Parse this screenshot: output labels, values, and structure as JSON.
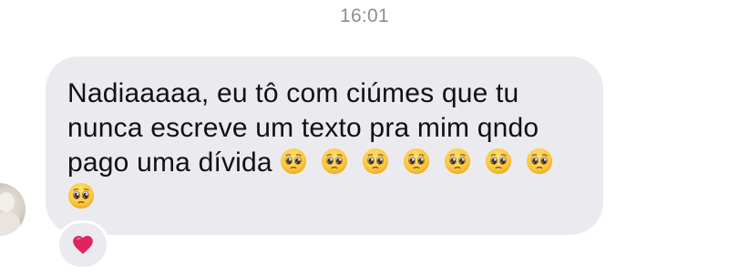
{
  "chat": {
    "timestamp": "16:01",
    "message": {
      "text": "Nadiaaaaa, eu tô com ciúmes que tu nunca escreve um texto pra mim qndo pago uma dívida",
      "emoji_count": 8,
      "emoji_name": "pleading-face-icon"
    },
    "reaction": {
      "icon": "red-heart-icon",
      "color": "#e0245e"
    }
  },
  "colors": {
    "bubble": "#ebebef",
    "timestamp": "#8e8e93",
    "text": "#111111"
  }
}
